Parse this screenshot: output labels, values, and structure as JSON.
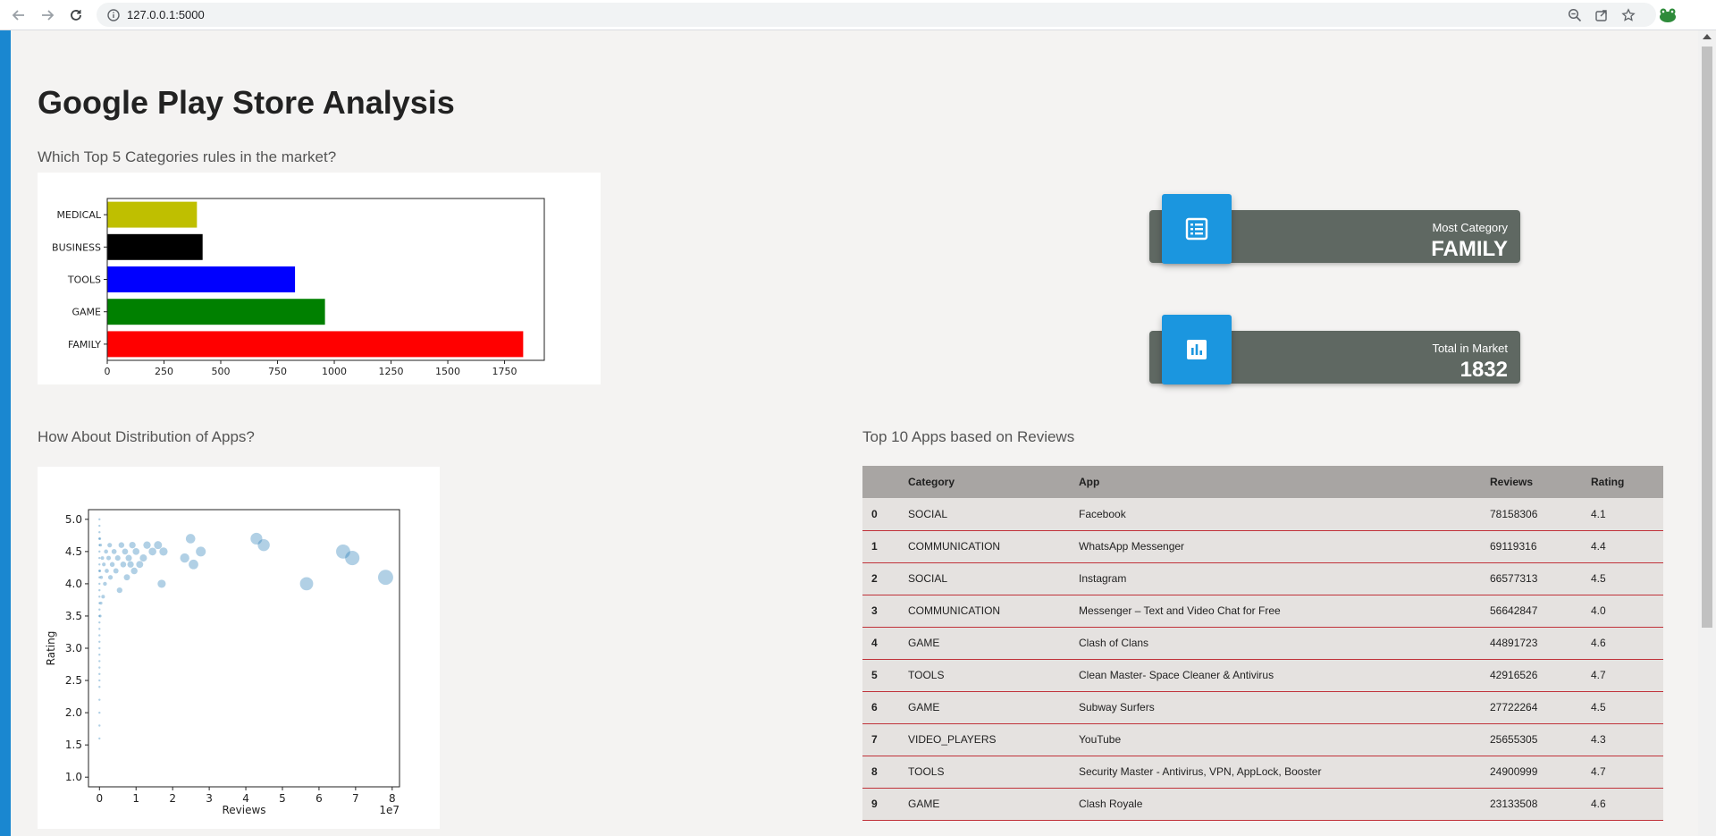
{
  "browser": {
    "url": "127.0.0.1:5000",
    "icons": [
      "back-arrow-icon",
      "forward-arrow-icon",
      "reload-icon",
      "info-icon",
      "zoom-icon",
      "share-icon",
      "star-icon",
      "extension-icon"
    ]
  },
  "page": {
    "title": "Google Play Store Analysis",
    "sections": {
      "top_categories": "Which Top 5 Categories rules in the market?",
      "distribution": "How About Distribution of Apps?",
      "top_apps": "Top 10 Apps based on Reviews"
    }
  },
  "cards": [
    {
      "label": "Most Category",
      "value": "FAMILY",
      "icon": "list-document-icon"
    },
    {
      "label": "Total in Market",
      "value": "1832",
      "icon": "bar-chart-icon"
    }
  ],
  "chart_data": [
    {
      "type": "bar",
      "orientation": "horizontal",
      "categories": [
        "FAMILY",
        "GAME",
        "TOOLS",
        "BUSINESS",
        "MEDICAL"
      ],
      "values": [
        1832,
        959,
        827,
        420,
        395
      ],
      "colors": [
        "#ff0000",
        "#008000",
        "#0000ff",
        "#000000",
        "#bfbf00"
      ],
      "xticks": [
        "0",
        "250",
        "500",
        "750",
        "1000",
        "1250",
        "1500",
        "1750"
      ],
      "xlim": [
        0,
        1925
      ],
      "grid": false
    },
    {
      "type": "scatter",
      "xlabel": "Reviews",
      "ylabel": "Rating",
      "x_offset_label": "1e7",
      "xticks": [
        "0",
        "1",
        "2",
        "3",
        "4",
        "5",
        "6",
        "7",
        "8"
      ],
      "yticks": [
        "1.0",
        "1.5",
        "2.0",
        "2.5",
        "3.0",
        "3.5",
        "4.0",
        "4.5",
        "5.0"
      ],
      "xlim": [
        -0.3,
        8.2
      ],
      "ylim": [
        0.85,
        5.15
      ],
      "color": "#1f77b4",
      "grid": false,
      "points": [
        {
          "x": 7.82,
          "y": 4.1
        },
        {
          "x": 6.91,
          "y": 4.4
        },
        {
          "x": 6.66,
          "y": 4.5
        },
        {
          "x": 5.66,
          "y": 4.0
        },
        {
          "x": 4.49,
          "y": 4.6
        },
        {
          "x": 4.29,
          "y": 4.7
        },
        {
          "x": 2.77,
          "y": 4.5
        },
        {
          "x": 2.57,
          "y": 4.3
        },
        {
          "x": 2.49,
          "y": 4.7
        },
        {
          "x": 2.33,
          "y": 4.4
        },
        {
          "x": 1.7,
          "y": 4.0
        },
        {
          "x": 1.75,
          "y": 4.5
        },
        {
          "x": 1.6,
          "y": 4.6
        },
        {
          "x": 1.45,
          "y": 4.5
        },
        {
          "x": 1.3,
          "y": 4.6
        },
        {
          "x": 1.2,
          "y": 4.4
        },
        {
          "x": 1.1,
          "y": 4.3
        },
        {
          "x": 1.0,
          "y": 4.5
        },
        {
          "x": 0.95,
          "y": 4.2
        },
        {
          "x": 0.9,
          "y": 4.6
        },
        {
          "x": 0.85,
          "y": 4.3
        },
        {
          "x": 0.8,
          "y": 4.4
        },
        {
          "x": 0.75,
          "y": 4.1
        },
        {
          "x": 0.7,
          "y": 4.5
        },
        {
          "x": 0.65,
          "y": 4.3
        },
        {
          "x": 0.6,
          "y": 4.6
        },
        {
          "x": 0.55,
          "y": 3.9
        },
        {
          "x": 0.5,
          "y": 4.4
        },
        {
          "x": 0.45,
          "y": 4.2
        },
        {
          "x": 0.4,
          "y": 4.5
        },
        {
          "x": 0.35,
          "y": 4.3
        },
        {
          "x": 0.3,
          "y": 4.1
        },
        {
          "x": 0.28,
          "y": 4.6
        },
        {
          "x": 0.25,
          "y": 4.4
        },
        {
          "x": 0.2,
          "y": 4.2
        },
        {
          "x": 0.18,
          "y": 4.5
        },
        {
          "x": 0.15,
          "y": 4.0
        },
        {
          "x": 0.12,
          "y": 4.3
        },
        {
          "x": 0.1,
          "y": 3.8
        },
        {
          "x": 0.08,
          "y": 4.4
        },
        {
          "x": 0.05,
          "y": 4.1
        },
        {
          "x": 0.04,
          "y": 3.7
        },
        {
          "x": 0.03,
          "y": 4.6
        },
        {
          "x": 0.02,
          "y": 3.5
        },
        {
          "x": 0.01,
          "y": 4.2
        },
        {
          "x": 0.01,
          "y": 4.7
        },
        {
          "x": 0.0,
          "y": 4.9
        },
        {
          "x": 0.0,
          "y": 4.8
        },
        {
          "x": 0.0,
          "y": 4.7
        },
        {
          "x": 0.0,
          "y": 4.6
        },
        {
          "x": 0.0,
          "y": 4.5
        },
        {
          "x": 0.0,
          "y": 4.4
        },
        {
          "x": 0.0,
          "y": 4.3
        },
        {
          "x": 0.0,
          "y": 4.2
        },
        {
          "x": 0.0,
          "y": 4.1
        },
        {
          "x": 0.0,
          "y": 4.0
        },
        {
          "x": 0.0,
          "y": 3.9
        },
        {
          "x": 0.0,
          "y": 3.8
        },
        {
          "x": 0.0,
          "y": 3.7
        },
        {
          "x": 0.0,
          "y": 3.6
        },
        {
          "x": 0.0,
          "y": 3.5
        },
        {
          "x": 0.0,
          "y": 3.4
        },
        {
          "x": 0.0,
          "y": 3.3
        },
        {
          "x": 0.0,
          "y": 3.2
        },
        {
          "x": 0.0,
          "y": 3.1
        },
        {
          "x": 0.0,
          "y": 3.0
        },
        {
          "x": 0.0,
          "y": 2.9
        },
        {
          "x": 0.0,
          "y": 2.8
        },
        {
          "x": 0.0,
          "y": 2.7
        },
        {
          "x": 0.0,
          "y": 2.6
        },
        {
          "x": 0.0,
          "y": 2.5
        },
        {
          "x": 0.0,
          "y": 2.4
        },
        {
          "x": 0.0,
          "y": 2.2
        },
        {
          "x": 0.0,
          "y": 2.0
        },
        {
          "x": 0.0,
          "y": 1.8
        },
        {
          "x": 0.0,
          "y": 1.6
        },
        {
          "x": 0.0,
          "y": 5.0
        }
      ]
    }
  ],
  "table": {
    "headers": [
      "",
      "Category",
      "App",
      "Reviews",
      "Rating"
    ],
    "rows": [
      {
        "idx": "0",
        "category": "SOCIAL",
        "app": "Facebook",
        "reviews": "78158306",
        "rating": "4.1"
      },
      {
        "idx": "1",
        "category": "COMMUNICATION",
        "app": "WhatsApp Messenger",
        "reviews": "69119316",
        "rating": "4.4"
      },
      {
        "idx": "2",
        "category": "SOCIAL",
        "app": "Instagram",
        "reviews": "66577313",
        "rating": "4.5"
      },
      {
        "idx": "3",
        "category": "COMMUNICATION",
        "app": "Messenger – Text and Video Chat for Free",
        "reviews": "56642847",
        "rating": "4.0"
      },
      {
        "idx": "4",
        "category": "GAME",
        "app": "Clash of Clans",
        "reviews": "44891723",
        "rating": "4.6"
      },
      {
        "idx": "5",
        "category": "TOOLS",
        "app": "Clean Master- Space Cleaner & Antivirus",
        "reviews": "42916526",
        "rating": "4.7"
      },
      {
        "idx": "6",
        "category": "GAME",
        "app": "Subway Surfers",
        "reviews": "27722264",
        "rating": "4.5"
      },
      {
        "idx": "7",
        "category": "VIDEO_PLAYERS",
        "app": "YouTube",
        "reviews": "25655305",
        "rating": "4.3"
      },
      {
        "idx": "8",
        "category": "TOOLS",
        "app": "Security Master - Antivirus, VPN, AppLock, Booster",
        "reviews": "24900999",
        "rating": "4.7"
      },
      {
        "idx": "9",
        "category": "GAME",
        "app": "Clash Royale",
        "reviews": "23133508",
        "rating": "4.6"
      }
    ]
  }
}
